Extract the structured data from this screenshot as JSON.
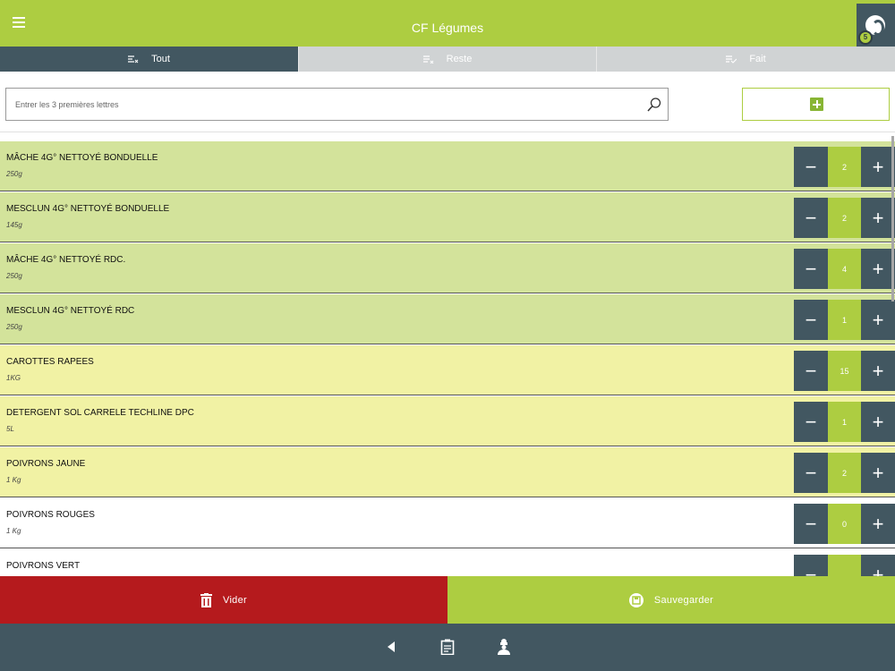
{
  "header": {
    "title": "CF Légumes",
    "menu_icon": "hamburger-menu-icon",
    "cart_badge": "5"
  },
  "tabs": [
    {
      "label": "Tout",
      "icon": "filter-all-icon",
      "active": true
    },
    {
      "label": "Reste",
      "icon": "filter-remaining-icon",
      "active": false
    },
    {
      "label": "Fait",
      "icon": "filter-done-icon",
      "active": false
    }
  ],
  "search": {
    "placeholder": "Entrer les 3 premières lettres",
    "value": ""
  },
  "items": [
    {
      "name": "MÂCHE 4G° NETTOYÉ BONDUELLE",
      "size": "250g",
      "qty": "2",
      "state": "green"
    },
    {
      "name": "MESCLUN 4G° NETTOYÉ BONDUELLE",
      "size": "145g",
      "qty": "2",
      "state": "green"
    },
    {
      "name": "MÂCHE 4G° NETTOYÉ RDC.",
      "size": "250g",
      "qty": "4",
      "state": "green"
    },
    {
      "name": "MESCLUN 4G° NETTOYÉ RDC",
      "size": "250g",
      "qty": "1",
      "state": "green"
    },
    {
      "name": "CAROTTES RAPEES",
      "size": "1KG",
      "qty": "15",
      "state": "yellow"
    },
    {
      "name": "DETERGENT SOL CARRELE TECHLINE DPC",
      "size": "5L",
      "qty": "1",
      "state": "yellow"
    },
    {
      "name": "POIVRONS JAUNE",
      "size": "1 Kg",
      "qty": "2",
      "state": "yellow"
    },
    {
      "name": "POIVRONS ROUGES",
      "size": "1 Kg",
      "qty": "0",
      "state": "white"
    },
    {
      "name": "POIVRONS VERT",
      "size": "",
      "qty": "",
      "state": "white"
    }
  ],
  "actions": {
    "clear_label": "Vider",
    "save_label": "Sauvegarder"
  },
  "colors": {
    "brand_green": "#adcd41",
    "dark_slate": "#425761",
    "danger_red": "#b51a1d",
    "row_green": "#d3e39b",
    "row_yellow": "#f1f2a4"
  },
  "bottom_nav": [
    "back-icon",
    "clipboard-icon",
    "chef-icon"
  ]
}
